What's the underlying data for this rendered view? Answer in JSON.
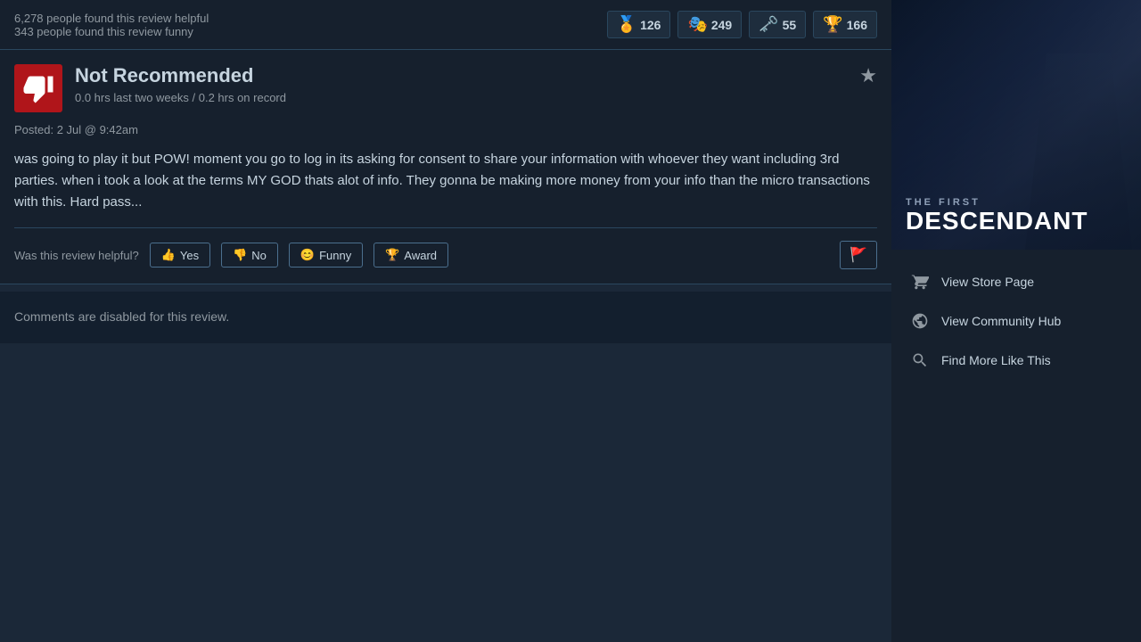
{
  "stats_bar": {
    "helpful_text": "6,278 people found this review helpful",
    "funny_text": "343 people found this review funny",
    "awards": [
      {
        "id": "award1",
        "icon": "🏅",
        "count": "126"
      },
      {
        "id": "award2",
        "icon": "🎭",
        "count": "249"
      },
      {
        "id": "award3",
        "icon": "🔑",
        "count": "55"
      },
      {
        "id": "award4",
        "icon": "🏆",
        "count": "166"
      }
    ]
  },
  "review": {
    "title": "Not Recommended",
    "hours": "0.0 hrs last two weeks / 0.2 hrs on record",
    "date": "Posted: 2 Jul @ 9:42am",
    "body": "was going to play it but POW! moment you go to log in its asking for consent to share your information with whoever they want including 3rd parties. when i took a look at the terms MY GOD thats alot of info. They gonna be making more money from your info than the micro transactions with this. Hard pass...",
    "star_label": "★"
  },
  "helpful_row": {
    "label": "Was this review helpful?",
    "yes_label": "Yes",
    "no_label": "No",
    "funny_label": "Funny",
    "award_label": "Award"
  },
  "comments": {
    "disabled_text": "Comments are disabled for this review."
  },
  "sidebar": {
    "game_title_line1": "THE FIRST",
    "game_title_line2": "DESCENDANT",
    "links": [
      {
        "id": "store",
        "label": "View Store Page",
        "icon": "cart"
      },
      {
        "id": "community",
        "label": "View Community Hub",
        "icon": "globe"
      },
      {
        "id": "similar",
        "label": "Find More Like This",
        "icon": "search"
      }
    ]
  }
}
